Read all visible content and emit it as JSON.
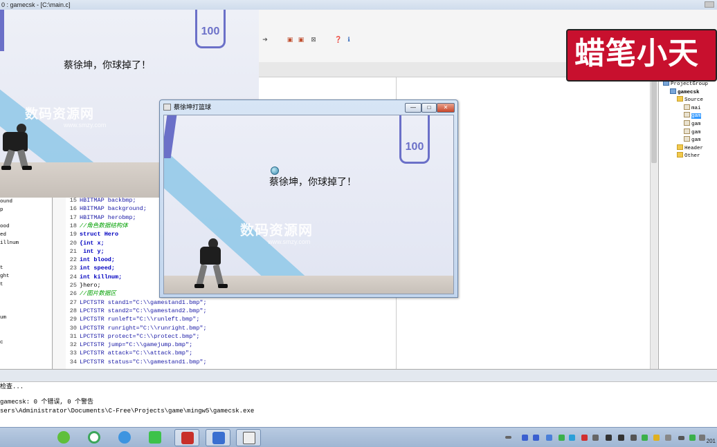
{
  "ide": {
    "title": "0 : gamecsk - [C:\\main.c]"
  },
  "symbols": [
    "ound",
    "p",
    "",
    "ood",
    "ed",
    "illnum",
    "",
    "",
    "t",
    "ght",
    "t",
    "",
    "",
    "",
    "um",
    "",
    "",
    "c"
  ],
  "code": [
    {
      "n": "15",
      "t": "HBITMAP backbmp;"
    },
    {
      "n": "16",
      "t": "HBITMAP background;"
    },
    {
      "n": "17",
      "t": "HBITMAP herobmp;"
    },
    {
      "n": "18",
      "t": "//角色数据结构体"
    },
    {
      "n": "19",
      "t": "struct Hero"
    },
    {
      "n": "20",
      "t": "{int x;"
    },
    {
      "n": "21",
      "t": " int y;"
    },
    {
      "n": "22",
      "t": "int blood;"
    },
    {
      "n": "23",
      "t": "int speed;"
    },
    {
      "n": "24",
      "t": "int killnum;"
    },
    {
      "n": "25",
      "t": "}hero;"
    },
    {
      "n": "26",
      "t": "//图片数据区"
    },
    {
      "n": "27",
      "t": "LPCTSTR stand1=\"C:\\\\gamestand1.bmp\";"
    },
    {
      "n": "28",
      "t": "LPCTSTR stand2=\"C:\\\\gamestand2.bmp\";"
    },
    {
      "n": "29",
      "t": "LPCTSTR runleft=\"C:\\\\runleft.bmp\";"
    },
    {
      "n": "30",
      "t": "LPCTSTR runright=\"C:\\\\runright.bmp\";"
    },
    {
      "n": "31",
      "t": "LPCTSTR protect=\"C:\\\\protect.bmp\";"
    },
    {
      "n": "32",
      "t": "LPCTSTR jump=\"C:\\\\gamejump.bmp\";"
    },
    {
      "n": "33",
      "t": "LPCTSTR attack=\"C:\\\\attack.bmp\";"
    },
    {
      "n": "34",
      "t": "LPCTSTR status=\"C:\\\\gamestand1.bmp\";"
    }
  ],
  "project_tree": [
    {
      "label": "ProjectGroup",
      "kind": "group",
      "indent": 0
    },
    {
      "label": "gamecsk",
      "kind": "proj",
      "indent": 1
    },
    {
      "label": "Source",
      "kind": "folder",
      "indent": 2
    },
    {
      "label": "mai",
      "kind": "file",
      "indent": 3
    },
    {
      "label": "gam",
      "kind": "cfile",
      "indent": 3,
      "selected": true
    },
    {
      "label": "gam",
      "kind": "cfile",
      "indent": 3
    },
    {
      "label": "gam",
      "kind": "cfile",
      "indent": 3
    },
    {
      "label": "gam",
      "kind": "cfile",
      "indent": 3
    },
    {
      "label": "Header",
      "kind": "folder",
      "indent": 2
    },
    {
      "label": "Other",
      "kind": "folder",
      "indent": 2
    }
  ],
  "output": {
    "lines": [
      "检查...",
      "gamecsk: 0 个错误, 0 个警告",
      "sers\\Administrator\\Documents\\C-Free\\Projects\\game\\mingw5\\gamecsk.exe"
    ]
  },
  "game_window": {
    "title": "蔡徐坤打篮球",
    "message": "蔡徐坤，你球掉了！",
    "logo_text": "100",
    "watermark": "数码资源网",
    "watermark_sub": "www.smzy.com"
  },
  "background_image": {
    "message": "蔡徐坤，你球掉了！",
    "logo_text": "100",
    "watermark": "数码资源网",
    "watermark_sub": "www.smzy.com"
  },
  "banner": {
    "text": "蜡笔小天",
    "color": "#c8102e"
  },
  "taskbar": {
    "clock": "201"
  },
  "colors": {
    "keyword": "#0000c0",
    "comment": "#00a000",
    "accent_stripe": "#8fc8e8",
    "logo": "#6b70c8"
  }
}
